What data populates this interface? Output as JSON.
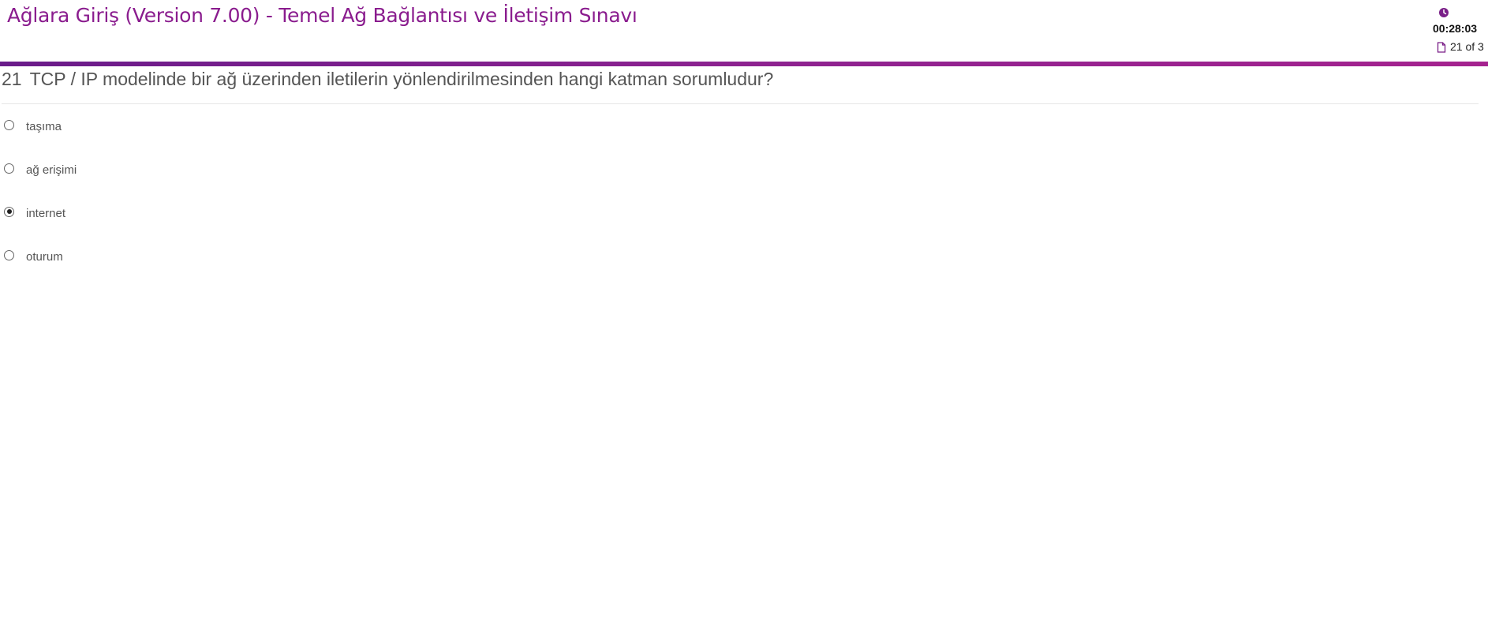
{
  "header": {
    "title": "Ağlara Giriş (Version 7.00) - Temel Ağ Bağlantısı ve İletişim Sınavı",
    "timer": "00:28:03",
    "progress": "21 of 3",
    "clock_icon": "clock-icon",
    "page_icon": "document-icon"
  },
  "colors": {
    "brand": "#8a1c8e",
    "accent_bar_start": "#6a1c8a",
    "accent_bar_end": "#a5228f"
  },
  "question": {
    "number": "21",
    "text": "TCP / IP modelinde bir ağ üzerinden iletilerin yönlendirilmesinden hangi katman sorumludur?"
  },
  "options": [
    {
      "label": "taşıma",
      "selected": false
    },
    {
      "label": "ağ erişimi",
      "selected": false
    },
    {
      "label": "internet",
      "selected": true
    },
    {
      "label": "oturum",
      "selected": false
    }
  ]
}
